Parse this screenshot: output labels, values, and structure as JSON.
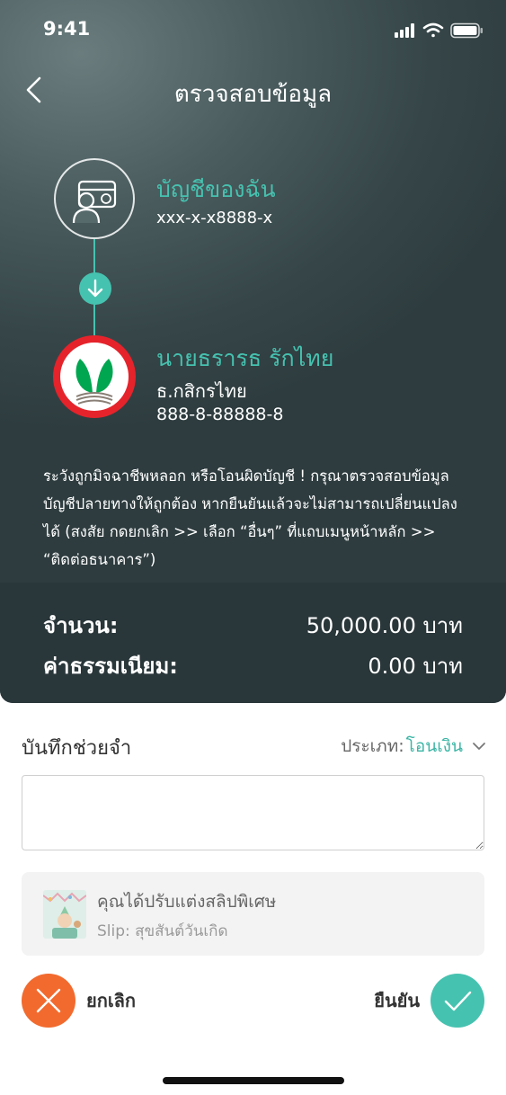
{
  "status_bar": {
    "time": "9:41"
  },
  "header": {
    "title": "ตรวจสอบข้อมูล"
  },
  "from_account": {
    "name": "บัญชีของฉัน",
    "number": "xxx-x-x8888-x"
  },
  "to_account": {
    "name": "นายธรารธ รักไทย",
    "bank": "ธ.กสิกรไทย",
    "number": "888-8-88888-8"
  },
  "warning_text": "ระวังถูกมิจฉาชีพหลอก หรือโอนผิดบัญชี ! กรุณาตรวจสอบข้อมูลบัญชีปลายทางให้ถูกต้อง หากยืนยันแล้วจะไม่สามารถเปลี่ยนแปลงได้ (สงสัย กดยกเลิก >> เลือก “อื่นๆ” ที่แถบเมนูหน้าหลัก >> “ติดต่อธนาคาร”)",
  "summary": {
    "amount_label": "จำนวน:",
    "amount_value": "50,000.00 บาท",
    "fee_label": "ค่าธรรมเนียม:",
    "fee_value": "0.00 บาท"
  },
  "memo": {
    "label": "บันทึกช่วยจำ",
    "value": "",
    "placeholder": ""
  },
  "type_selector": {
    "label": "ประเภท:",
    "value": "โอนเงิน"
  },
  "slip": {
    "title": "คุณได้ปรับแต่งสลิปพิเศษ",
    "subtitle": "Slip: สุขสันต์วันเกิด"
  },
  "actions": {
    "cancel_label": "ยกเลิก",
    "confirm_label": "ยืนยัน"
  },
  "colors": {
    "accent": "#46c2b0",
    "cancel": "#f26a2e",
    "bank_red": "#e5232b",
    "bank_green": "#00a650",
    "dark_bg": "#364648"
  }
}
